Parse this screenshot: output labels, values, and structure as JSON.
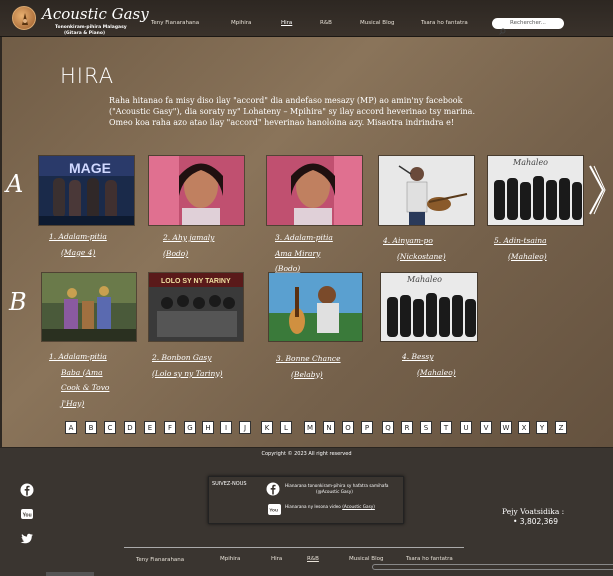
{
  "header": {
    "logo_title": "Acoustic Gasy",
    "logo_sub1": "Tononkiram-pihira Malagasy",
    "logo_sub2": "(Gitara & Piano)",
    "nav": [
      "Teny Fianarahana",
      "Mpihira",
      "Hira",
      "R&B",
      "Musical Blog",
      "Tsara ho fantatra"
    ],
    "active_nav": "Hira",
    "search_placeholder": "Rechercher..."
  },
  "page": {
    "title": "HIRA",
    "intro_lines": [
      "Raha hitanao fa misy diso ilay \"accord\" dia andefaso mesazy (MP) ao amin'ny facebook",
      "(\"Acoustic Gasy\"), dia soraty ny\" Lohateny – Mpihira\" sy ilay accord heverinao tsy marina.",
      "Omeo koa raha azo atao ilay \"accord\" heverinao hanoloina azy. Misaotra indrindra e!"
    ]
  },
  "rows": [
    {
      "letter": "A",
      "albums": [
        {
          "caption": [
            "1. Adalam-pitia",
            "(Mage 4)"
          ],
          "underline": [
            true,
            true
          ]
        },
        {
          "caption": [
            "2. Ahy jamaly",
            "(Bodo)"
          ],
          "underline": [
            true,
            true
          ]
        },
        {
          "caption": [
            "3. Adalam-pitia",
            "Ama Mirary",
            "(Bodo)"
          ],
          "underline": [
            true,
            true,
            true
          ]
        },
        {
          "caption": [
            "4. Ainyam-po",
            "(Nickostane)"
          ],
          "underline": [
            true,
            true
          ]
        },
        {
          "caption": [
            "5. Adin-tsaina",
            "(Mahaleo)"
          ],
          "underline": [
            true,
            true
          ]
        }
      ]
    },
    {
      "letter": "B",
      "albums": [
        {
          "caption": [
            "1. Adalam-pitia",
            "Baba (Ama",
            "Cook & Tovo",
            "J'Hay)"
          ],
          "underline": [
            true,
            true,
            true,
            true
          ]
        },
        {
          "caption": [
            "2. Bonbon Gasy",
            "(Lolo sy ny Tariny)"
          ],
          "underline": [
            true,
            true
          ]
        },
        {
          "caption": [
            "3. Bonne Chance",
            "(Belaby)"
          ],
          "underline": [
            true,
            true
          ]
        },
        {
          "caption": [
            "4. Bessy",
            "(Mahaleo)"
          ],
          "underline": [
            true,
            true
          ]
        }
      ]
    }
  ],
  "alphabet": [
    "A",
    "B",
    "C",
    "D",
    "E",
    "F",
    "G",
    "H",
    "I",
    "J",
    "K",
    "L",
    "M",
    "N",
    "O",
    "P",
    "Q",
    "R",
    "S",
    "T",
    "U",
    "V",
    "W",
    "X",
    "Y",
    "Z"
  ],
  "footer": {
    "copyright": "Copyright © 2023 All right reserved",
    "follow_label": "SUIVEZ-NOUS",
    "fb_text_1": "Hianarana tononkiram-pihira sy hafatra samihafa",
    "fb_text_2": "(@Acoustic Gasy)",
    "yt_text": "Hianarana ny lesona video",
    "yt_link": "(Acoustic Gasy)",
    "visits_label": "Pejy Voatsidika :",
    "visits_count": "•  3,802,369",
    "nav": [
      "Teny Fianarahana",
      "Mpihira",
      "Hira",
      "R&B",
      "Musical Blog",
      "Tsara ho fantatra"
    ]
  },
  "colors": {
    "header_bg": "#2d2722",
    "footer_bg": "#3a3530",
    "text": "#ffffff"
  },
  "icons": [
    "facebook-icon",
    "youtube-icon",
    "twitter-icon",
    "search-icon",
    "next-arrow-icon"
  ]
}
